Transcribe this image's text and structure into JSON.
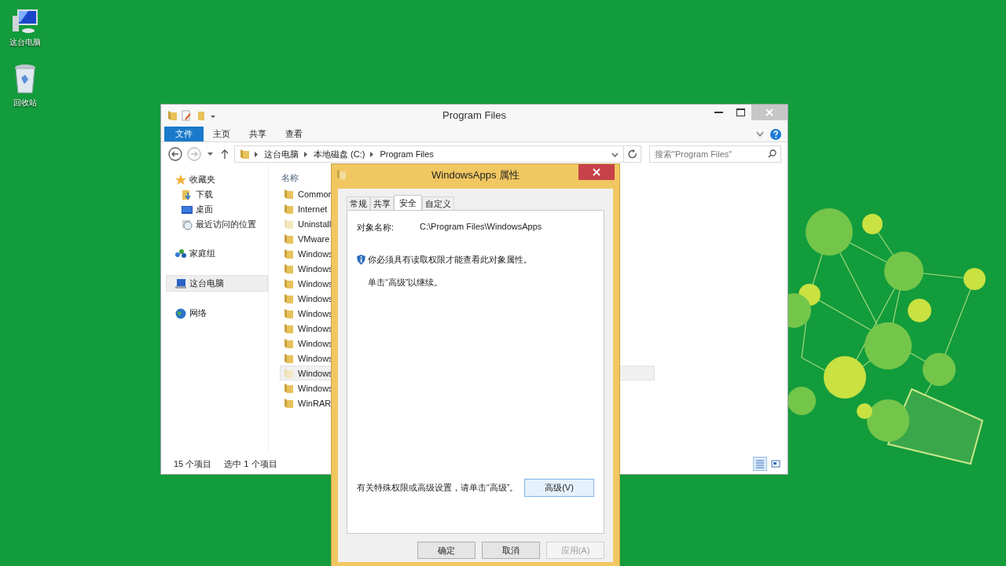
{
  "desktop": {
    "icons": [
      {
        "label": "这台电脑",
        "kind": "computer"
      },
      {
        "label": "回收站",
        "kind": "recycle"
      }
    ]
  },
  "explorer": {
    "title": "Program Files",
    "ribbon_tabs": [
      {
        "label": "文件",
        "kind": "file"
      },
      {
        "label": "主页",
        "kind": "tab"
      },
      {
        "label": "共享",
        "kind": "tab"
      },
      {
        "label": "查看",
        "kind": "tab"
      }
    ],
    "breadcrumbs": [
      "这台电脑",
      "本地磁盘 (C:)",
      "Program Files"
    ],
    "search": {
      "placeholder": "搜索\"Program Files\""
    },
    "nav": [
      {
        "label": "收藏夹",
        "kind": "star",
        "selected": false,
        "children": [
          {
            "label": "下载",
            "kind": "download",
            "selected": false
          },
          {
            "label": "桌面",
            "kind": "desktop",
            "selected": false
          },
          {
            "label": "最近访问的位置",
            "kind": "recent",
            "selected": false
          }
        ]
      },
      {
        "label": "家庭组",
        "kind": "homegroup",
        "selected": false
      },
      {
        "label": "这台电脑",
        "kind": "computer",
        "selected": true
      },
      {
        "label": "网络",
        "kind": "network",
        "selected": false
      }
    ],
    "column": "名称",
    "files": [
      {
        "name": "Common",
        "hidden": false,
        "selected": false
      },
      {
        "name": "Internet",
        "hidden": false,
        "selected": false
      },
      {
        "name": "Uninstall",
        "hidden": true,
        "selected": false
      },
      {
        "name": "VMware",
        "hidden": false,
        "selected": false
      },
      {
        "name": "Windows",
        "hidden": false,
        "selected": false
      },
      {
        "name": "Windows",
        "hidden": false,
        "selected": false
      },
      {
        "name": "Windows",
        "hidden": false,
        "selected": false
      },
      {
        "name": "Windows",
        "hidden": false,
        "selected": false
      },
      {
        "name": "Windows",
        "hidden": false,
        "selected": false
      },
      {
        "name": "Windows",
        "hidden": false,
        "selected": false
      },
      {
        "name": "Windows",
        "hidden": false,
        "selected": false
      },
      {
        "name": "Windows",
        "hidden": false,
        "selected": false
      },
      {
        "name": "Windows",
        "hidden": true,
        "selected": true
      },
      {
        "name": "Windows",
        "hidden": false,
        "selected": false
      },
      {
        "name": "WinRAR",
        "hidden": false,
        "selected": false
      }
    ],
    "status": [
      "15 个项目",
      "选中 1 个项目"
    ]
  },
  "dialog": {
    "title": "WindowsApps 属性",
    "tabs": [
      {
        "label": "常规",
        "selected": false
      },
      {
        "label": "共享",
        "selected": false
      },
      {
        "label": "安全",
        "selected": true
      },
      {
        "label": "自定义",
        "selected": false
      }
    ],
    "object_label": "对象名称:",
    "object_value": "C:\\Program Files\\WindowsApps",
    "notice": "你必须具有读取权限才能查看此对象属性。",
    "hint": "单击“高级”以继续。",
    "advanced_text": "有关特殊权限或高级设置，请单击“高级”。",
    "advanced_button": {
      "label": "高级(V)",
      "hovered": true
    },
    "buttons": [
      {
        "label": "确定",
        "disabled": false
      },
      {
        "label": "取消",
        "disabled": false
      },
      {
        "label": "应用(A)",
        "disabled": true
      }
    ]
  }
}
